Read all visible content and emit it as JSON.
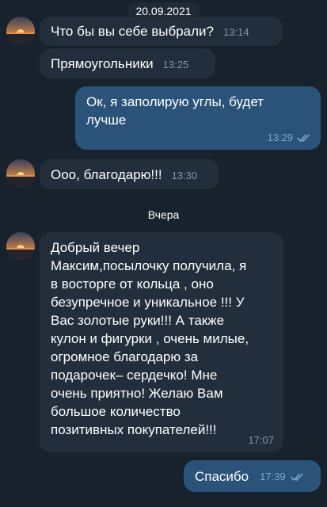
{
  "chat": {
    "date_top": "20.09.2021",
    "date_divider": "Вчера",
    "messages": [
      {
        "text": "Что бы  вы себе выбрали?",
        "time": "13:14"
      },
      {
        "text": "Прямоугольники",
        "time": "13:25"
      },
      {
        "text": "Ок, я заполирую углы, будет\nлучше",
        "time": "13:29"
      },
      {
        "text": "Ооо, благодарю!!!",
        "time": "13:30"
      },
      {
        "text": "Добрый вечер\nМаксим,посылочку получила,  я\nв восторге от кольца , оно\nбезупречное и уникальное !!! У\nВас золотые руки!!! А также\nкулон и фигурки , очень милые,\nогромное благодарю за\nподарочек– сердечко! Мне\nочень приятно! Желаю  Вам\nбольшое количество\nпозитивных покупателей!!!",
        "time": "17:07"
      },
      {
        "text": "Спасибо",
        "time": "17:39"
      }
    ]
  },
  "icons": {
    "avatar": "sunset-avatar-icon",
    "read_status": "double-check-icon"
  },
  "colors": {
    "background": "#18222d",
    "incoming_bubble": "#232e3c",
    "outgoing_bubble": "#2b5278",
    "time_incoming": "#8794a1",
    "time_outgoing": "#7fa7cf"
  }
}
